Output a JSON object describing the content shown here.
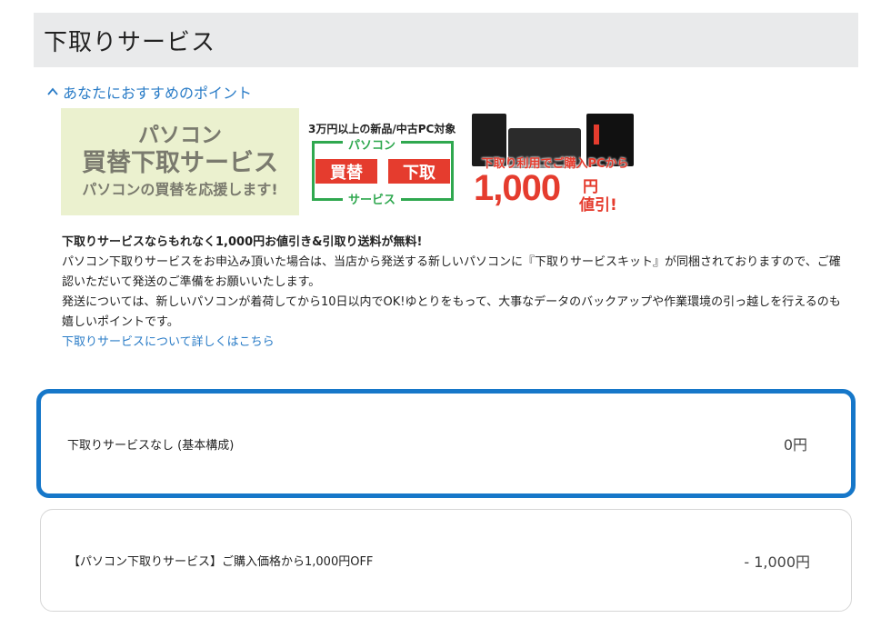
{
  "section": {
    "title": "下取りサービス"
  },
  "toggle": {
    "label": "あなたにおすすめのポイント",
    "icon": "chevron-up-icon"
  },
  "banner": {
    "left": {
      "line1": "パソコン",
      "line2": "買替下取サービス",
      "line3": "パソコンの買替を応援します!"
    },
    "middle": {
      "caption": "3万円以上の新品/中古PC対象",
      "top_label": "パソコン",
      "box1": "買替",
      "box2": "下取",
      "bottom_label": "サービス"
    },
    "right": {
      "promo": "下取り利用でご購入PCから",
      "amount": "1,000",
      "unit": "円",
      "discount": "値引!"
    }
  },
  "description": {
    "lead": "下取りサービスならもれなく1,000円お値引き&引取り送料が無料!",
    "para1": "パソコン下取りサービスをお申込み頂いた場合は、当店から発送する新しいパソコンに『下取りサービスキット』が同梱されておりますので、ご確認いただいて発送のご準備をお願いいたします。",
    "para2": "発送については、新しいパソコンが着荷してから10日以内でOK!ゆとりをもって、大事なデータのバックアップや作業環境の引っ越しを行えるのも嬉しいポイントです。",
    "link": "下取りサービスについて詳しくはこちら"
  },
  "options": [
    {
      "label": "下取りサービスなし (基本構成)",
      "price": "0円",
      "selected": true
    },
    {
      "label": "【パソコン下取りサービス】ご購入価格から1,000円OFF",
      "price": "- 1,000円",
      "selected": false
    }
  ],
  "colors": {
    "accent": "#1677c9",
    "link": "#2a7cc7",
    "header_bg": "#e9eaeb",
    "promo_red": "#e53c2e",
    "banner_green": "#2fa84f"
  }
}
